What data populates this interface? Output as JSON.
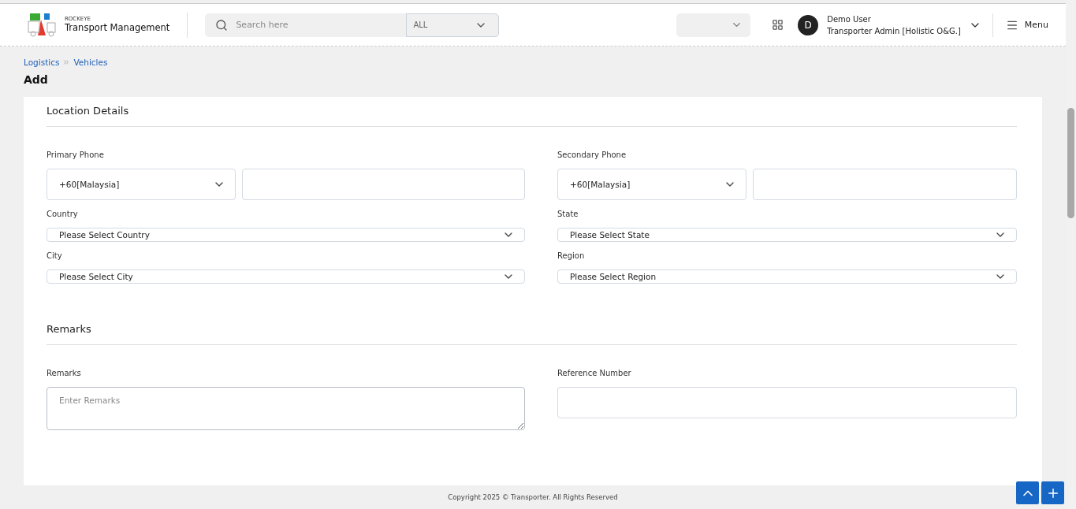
{
  "header": {
    "brand_small": "ROCKEYE",
    "brand_title": "Transport Management",
    "search": {
      "placeholder": "Search here",
      "scope": "ALL"
    },
    "user": {
      "initial": "D",
      "name": "Demo User",
      "role": "Transporter Admin [Holistic O&G.]"
    },
    "menu_label": "Menu"
  },
  "breadcrumb": [
    "Logistics",
    "Vehicles"
  ],
  "page_title": "Add",
  "sections": [
    {
      "title": "Location Details",
      "fields": [
        {
          "kind": "phone",
          "label": "Primary Phone",
          "code": "+60[Malaysia]"
        },
        {
          "kind": "phone",
          "label": "Secondary Phone",
          "code": "+60[Malaysia]"
        },
        {
          "kind": "select",
          "label": "Country",
          "placeholder": "Please Select Country"
        },
        {
          "kind": "select",
          "label": "State",
          "placeholder": "Please Select State"
        },
        {
          "kind": "select",
          "label": "City",
          "placeholder": "Please Select City"
        },
        {
          "kind": "select",
          "label": "Region",
          "placeholder": "Please Select Region"
        }
      ]
    },
    {
      "title": "Remarks",
      "fields": [
        {
          "kind": "textarea",
          "label": "Remarks",
          "placeholder": "Enter Remarks"
        },
        {
          "kind": "input",
          "label": "Reference Number"
        }
      ]
    }
  ],
  "footer": "Copyright 2025 © Transporter. All Rights Reserved"
}
